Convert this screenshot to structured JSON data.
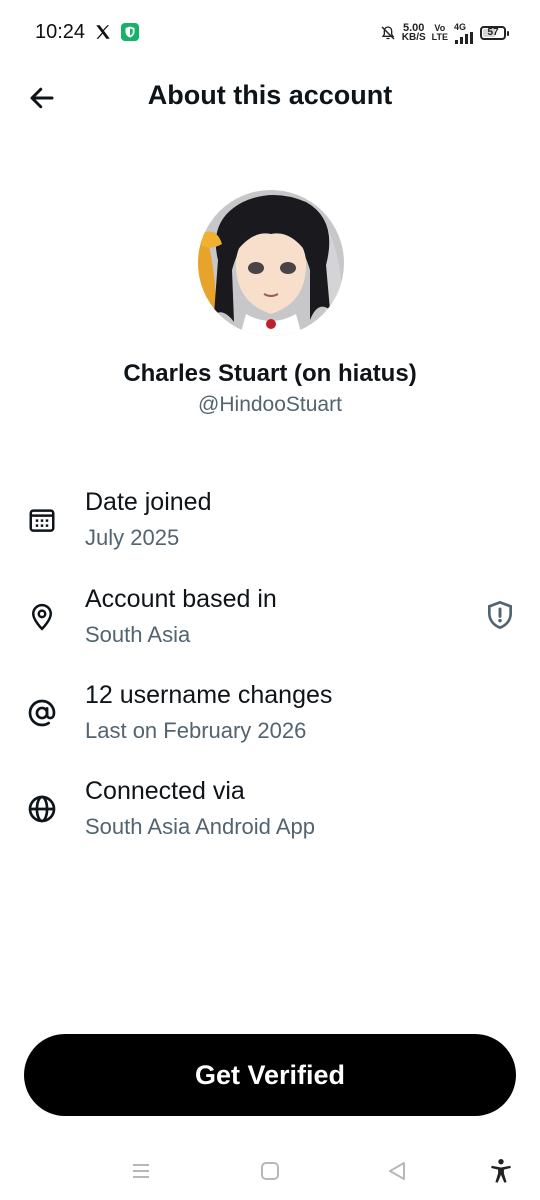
{
  "status_bar": {
    "time": "10:24",
    "network_speed_value": "5.00",
    "network_speed_unit": "KB/S",
    "volte_top": "Vo",
    "volte_bottom": "LTE",
    "network_type": "4G",
    "battery_level": "57",
    "icons": [
      "x-app-icon",
      "vpn-shield-icon",
      "muted-bell-icon",
      "signal-icon",
      "battery-icon"
    ]
  },
  "header": {
    "title": "About this account",
    "back_icon": "arrow-left-icon"
  },
  "profile": {
    "display_name": "Charles Stuart (on hiatus)",
    "handle": "@HindooStuart"
  },
  "info_items": [
    {
      "icon": "calendar-icon",
      "title": "Date joined",
      "subtitle": "July 2025"
    },
    {
      "icon": "location-pin-icon",
      "title": "Account based in",
      "subtitle": "South Asia",
      "action_icon": "shield-alert-icon"
    },
    {
      "icon": "at-sign-icon",
      "title": "12 username changes",
      "subtitle": "Last on February 2026"
    },
    {
      "icon": "globe-icon",
      "title": "Connected via",
      "subtitle": "South Asia Android App"
    }
  ],
  "actions": {
    "get_verified_label": "Get Verified"
  },
  "nav_bar": {
    "icons": [
      "menu-icon",
      "home-square-icon",
      "back-triangle-icon",
      "accessibility-icon"
    ]
  },
  "colors": {
    "text_primary": "#0f1419",
    "text_secondary": "#536471",
    "button_bg": "#000000",
    "button_text": "#ffffff"
  }
}
